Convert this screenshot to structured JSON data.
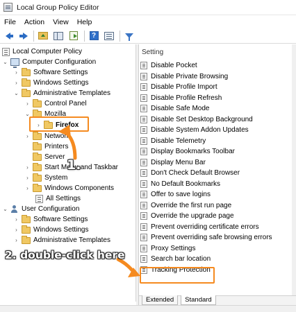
{
  "window": {
    "title": "Local Group Policy Editor"
  },
  "menu": [
    "File",
    "Action",
    "View",
    "Help"
  ],
  "toolbar": {
    "buttons": [
      "back-icon",
      "forward-icon",
      "up-folder-icon",
      "show-hide-tree-icon",
      "export-list-icon",
      "help-icon",
      "properties-icon",
      "filter-icon"
    ],
    "help_glyph": "?"
  },
  "tree": {
    "root": "Local Computer Policy",
    "computer_config": "Computer Configuration",
    "cc_software": "Software Settings",
    "cc_windows": "Windows Settings",
    "cc_admin": "Administrative Templates",
    "control_panel": "Control Panel",
    "mozilla": "Mozilla",
    "firefox": "Firefox",
    "network": "Network",
    "printers": "Printers",
    "server": "Server",
    "start_menu": "Start Menu and Taskbar",
    "system": "System",
    "windows_components": "Windows Components",
    "all_settings": "All Settings",
    "user_config": "User Configuration",
    "uc_software": "Software Settings",
    "uc_windows": "Windows Settings",
    "uc_admin": "Administrative Templates"
  },
  "settings_panel": {
    "column_header": "Setting",
    "items": [
      "Disable Pocket",
      "Disable Private Browsing",
      "Disable Profile Import",
      "Disable Profile Refresh",
      "Disable Safe Mode",
      "Disable Set Desktop Background",
      "Disable System Addon Updates",
      "Disable Telemetry",
      "Display Bookmarks Toolbar",
      "Display Menu Bar",
      "Don't Check Default Browser",
      "No Default Bookmarks",
      "Offer to save logins",
      "Override the first run page",
      "Override the upgrade page",
      "Prevent overriding certificate errors",
      "Prevent overriding safe browsing errors",
      "Proxy Settings",
      "Search bar location",
      "Tracking Protection"
    ]
  },
  "tabs": [
    "Extended",
    "Standard"
  ],
  "annotations": {
    "step1": "1.",
    "step2": "2. double-click here",
    "accent_color": "#f58a1f"
  }
}
